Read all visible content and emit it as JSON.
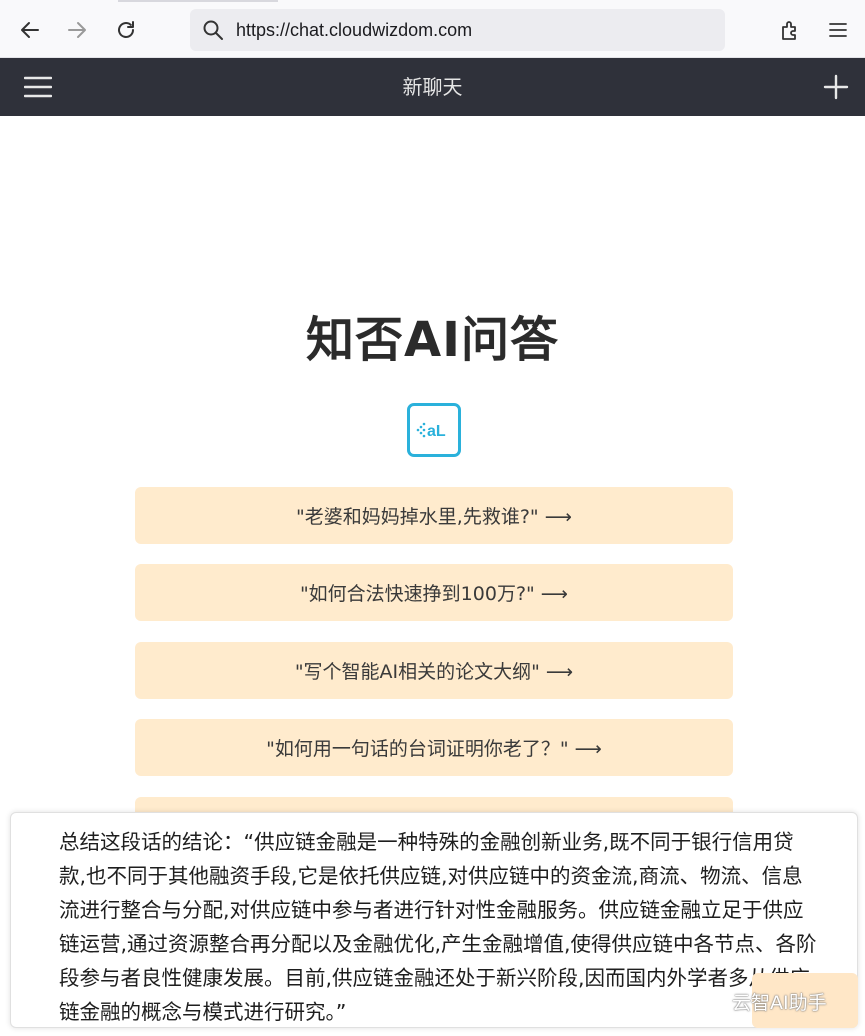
{
  "browser": {
    "url": "https://chat.cloudwizdom.com"
  },
  "header": {
    "title": "新聊天"
  },
  "main": {
    "title": "知否AI问答",
    "logo_text": "aL",
    "suggestions": [
      "\"老婆和妈妈掉水里,先救谁?\" ⟶",
      "\"如何合法快速挣到100万?\" ⟶",
      "\"写个智能AI相关的论文大纲\" ⟶",
      "\"如何用一句话的台词证明你老了？\" ⟶"
    ]
  },
  "input": {
    "text": "总结这段话的结论：“供应链金融是一种特殊的金融创新业务,既不同于银行信用贷款,也不同于其他融资手段,它是依托供应链,对供应链中的资金流,商流、物流、信息流进行整合与分配,对供应链中参与者进行针对性金融服务。供应链金融立足于供应链运营,通过资源整合再分配以及金融优化,产生金融增值,使得供应链中各节点、各阶段参与者良性健康发展。目前,供应链金融还处于新兴阶段,因而国内外学者多从供应链金融的概念与模式进行研究。”"
  },
  "watermark": {
    "text": "云智AI助手"
  },
  "colors": {
    "header_bg": "#2f313a",
    "suggestion_bg": "#ffebcd",
    "logo_accent": "#2ab1db"
  }
}
